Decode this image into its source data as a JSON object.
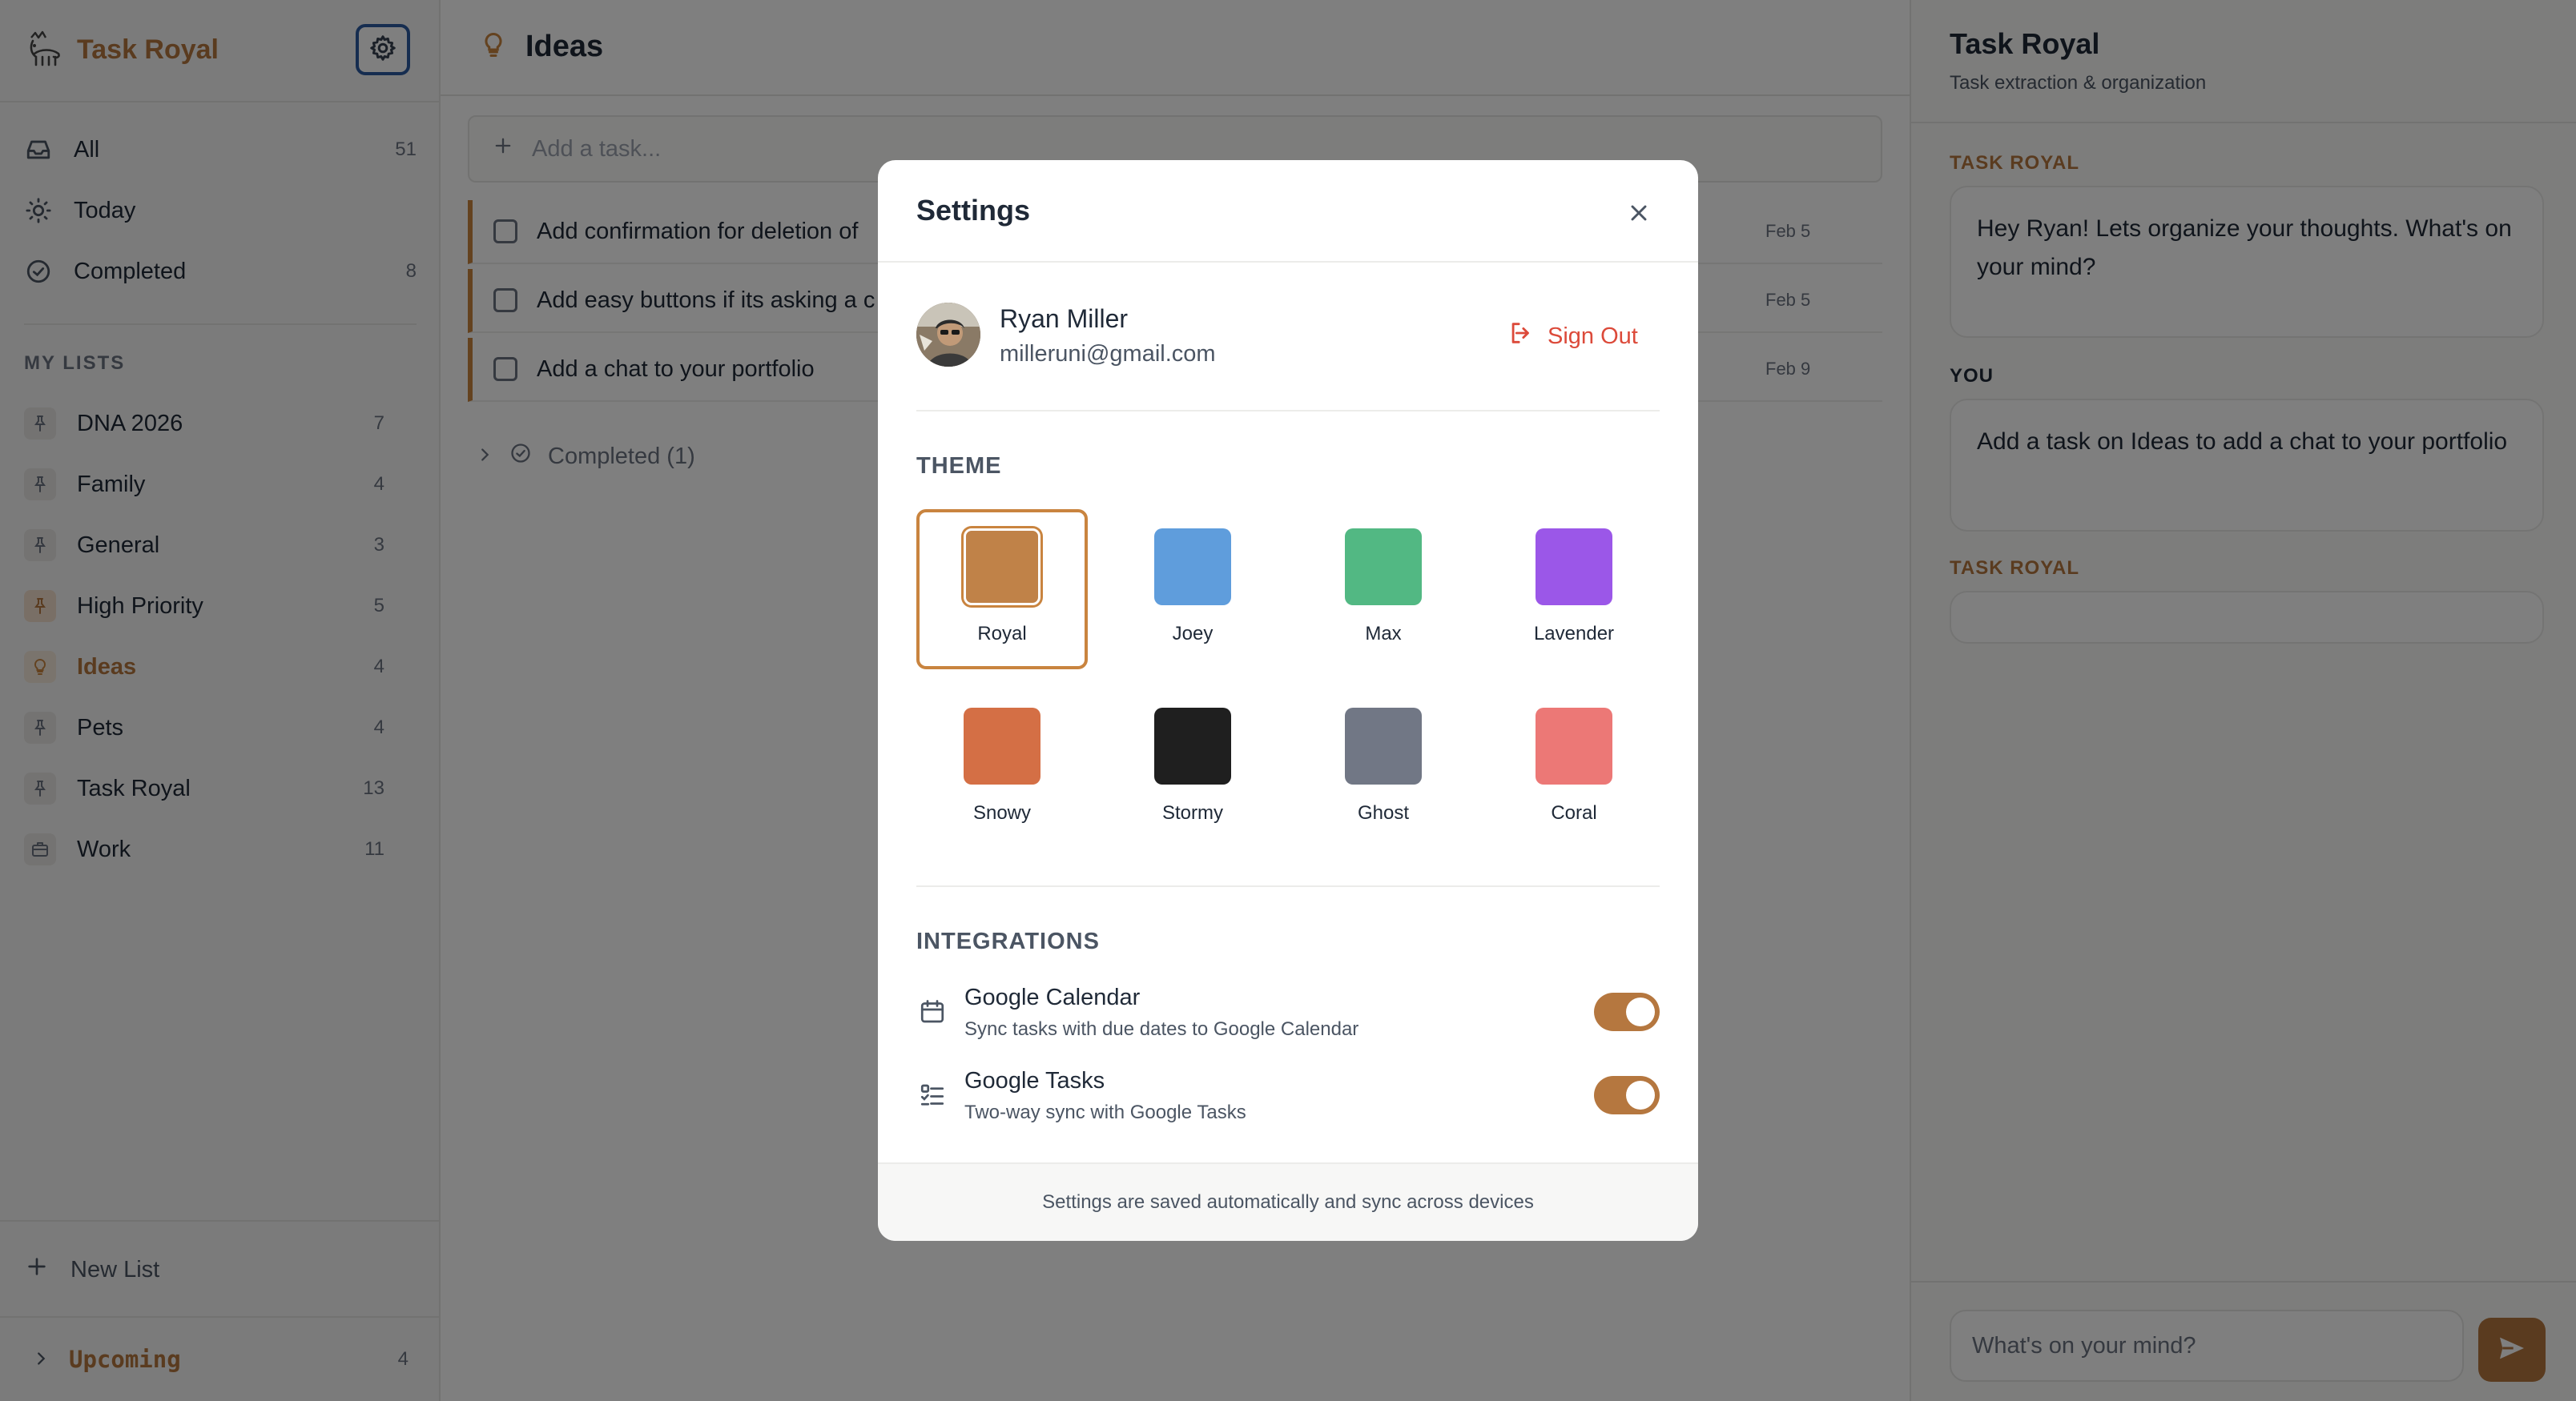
{
  "app": {
    "name": "Task Royal"
  },
  "sidebar": {
    "nav": [
      {
        "label": "All",
        "count": "51"
      },
      {
        "label": "Today",
        "count": ""
      },
      {
        "label": "Completed",
        "count": "8"
      }
    ],
    "section_title": "MY LISTS",
    "lists": [
      {
        "label": "DNA 2026",
        "count": "7"
      },
      {
        "label": "Family",
        "count": "4"
      },
      {
        "label": "General",
        "count": "3"
      },
      {
        "label": "High Priority",
        "count": "5"
      },
      {
        "label": "Ideas",
        "count": "4"
      },
      {
        "label": "Pets",
        "count": "4"
      },
      {
        "label": "Task Royal",
        "count": "13"
      },
      {
        "label": "Work",
        "count": "11"
      }
    ],
    "new_list": "New List",
    "upcoming": {
      "label": "Upcoming",
      "count": "4"
    }
  },
  "main": {
    "title": "Ideas",
    "add_task_placeholder": "Add a task...",
    "tasks": [
      {
        "title": "Add confirmation for deletion of",
        "date": "Feb 5"
      },
      {
        "title": "Add easy buttons if its asking a c",
        "date": "Feb 5"
      },
      {
        "title": "Add a chat to your portfolio",
        "date": "Feb 9"
      }
    ],
    "completed_toggle": "Completed (1)"
  },
  "chat": {
    "title": "Task Royal",
    "subtitle": "Task extraction & organization",
    "messages": [
      {
        "sender": "TASK ROYAL",
        "text": "Hey Ryan! Lets organize your thoughts. What's on your mind?"
      },
      {
        "sender": "YOU",
        "text": "Add a task on Ideas to add a chat to your portfolio"
      },
      {
        "sender": "TASK ROYAL",
        "text": ""
      }
    ],
    "input_placeholder": "What's on your mind?"
  },
  "settings": {
    "title": "Settings",
    "user": {
      "name": "Ryan Miller",
      "email": "milleruni@gmail.com"
    },
    "sign_out": "Sign Out",
    "theme_label": "THEME",
    "themes": [
      {
        "name": "Royal",
        "color": "#c08248",
        "selected": true
      },
      {
        "name": "Joey",
        "color": "#5f9ddc",
        "selected": false
      },
      {
        "name": "Max",
        "color": "#52b883",
        "selected": false
      },
      {
        "name": "Lavender",
        "color": "#9b57e8",
        "selected": false
      },
      {
        "name": "Snowy",
        "color": "#d46f45",
        "selected": false
      },
      {
        "name": "Stormy",
        "color": "#1f1f1f",
        "selected": false
      },
      {
        "name": "Ghost",
        "color": "#717785",
        "selected": false
      },
      {
        "name": "Coral",
        "color": "#ec7876",
        "selected": false
      }
    ],
    "integrations_label": "INTEGRATIONS",
    "integrations": [
      {
        "name": "Google Calendar",
        "desc": "Sync tasks with due dates to Google Calendar",
        "enabled": true,
        "icon": "calendar-icon"
      },
      {
        "name": "Google Tasks",
        "desc": "Two-way sync with Google Tasks",
        "enabled": true,
        "icon": "checklist-icon"
      }
    ],
    "footer": "Settings are saved automatically and sync across devices"
  },
  "colors": {
    "accent": "#b5773f",
    "danger": "#dc4a3a"
  }
}
